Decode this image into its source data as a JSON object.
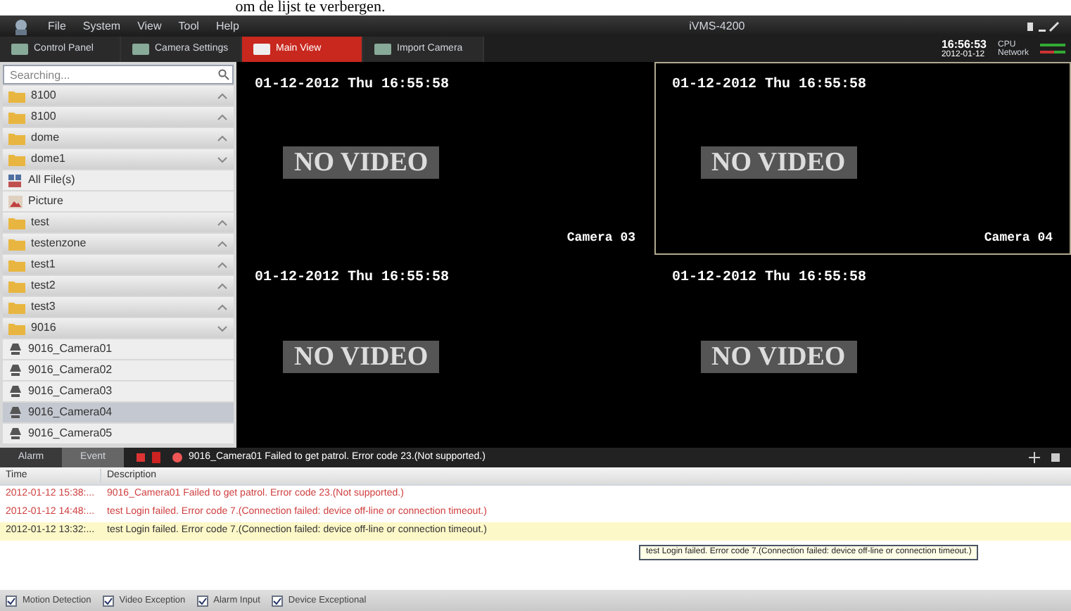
{
  "page_caption": "om de lijst te verbergen.",
  "window": {
    "title": "iVMS-4200"
  },
  "menu": [
    "File",
    "System",
    "View",
    "Tool",
    "Help"
  ],
  "toolbar_tabs": [
    {
      "label": "Control Panel",
      "selected": false
    },
    {
      "label": "Camera Settings",
      "selected": false
    },
    {
      "label": "Main View",
      "selected": true
    },
    {
      "label": "Import Camera",
      "selected": false
    }
  ],
  "status": {
    "time": "16:56:53",
    "date": "2012-01-12",
    "cpu_label": "CPU",
    "network_label": "Network"
  },
  "sidebar": {
    "search": {
      "placeholder": "Searching..."
    },
    "items": [
      {
        "kind": "folder",
        "label": "8100",
        "expanded": false
      },
      {
        "kind": "folder",
        "label": "8100",
        "expanded": false
      },
      {
        "kind": "folder",
        "label": "dome",
        "expanded": false
      },
      {
        "kind": "folder",
        "label": "dome1",
        "expanded": true
      },
      {
        "kind": "files",
        "label": "All File(s)"
      },
      {
        "kind": "picture",
        "label": "Picture"
      },
      {
        "kind": "folder",
        "label": "test",
        "expanded": false
      },
      {
        "kind": "folder",
        "label": "testenzone",
        "expanded": false
      },
      {
        "kind": "folder",
        "label": "test1",
        "expanded": false
      },
      {
        "kind": "folder",
        "label": "test2",
        "expanded": false
      },
      {
        "kind": "folder",
        "label": "test3",
        "expanded": false
      },
      {
        "kind": "folder",
        "label": "9016",
        "expanded": true
      },
      {
        "kind": "camera",
        "label": "9016_Camera01",
        "selected": false
      },
      {
        "kind": "camera",
        "label": "9016_Camera02",
        "selected": false
      },
      {
        "kind": "camera",
        "label": "9016_Camera03",
        "selected": false
      },
      {
        "kind": "camera",
        "label": "9016_Camera04",
        "selected": true
      },
      {
        "kind": "camera",
        "label": "9016_Camera05",
        "selected": false
      }
    ]
  },
  "video_tiles": [
    {
      "timestamp": "01-12-2012 Thu 16:55:58",
      "message": "NO VIDEO",
      "camera": "Camera 03",
      "selected": false
    },
    {
      "timestamp": "01-12-2012 Thu 16:55:58",
      "message": "NO VIDEO",
      "camera": "Camera 04",
      "selected": true
    },
    {
      "timestamp": "01-12-2012 Thu 16:55:58",
      "message": "NO VIDEO",
      "selected": false
    },
    {
      "timestamp": "01-12-2012 Thu 16:55:58",
      "message": "NO VIDEO",
      "selected": false
    }
  ],
  "event_bar": {
    "tabs": [
      {
        "label": "Alarm",
        "selected": false
      },
      {
        "label": "Event",
        "selected": true
      }
    ],
    "message": "9016_Camera01 Failed to get patrol. Error code 23.(Not supported.)"
  },
  "table": {
    "columns": [
      "Time",
      "Description"
    ],
    "rows": [
      {
        "time": "2012-01-12 15:38:...",
        "description": "9016_Camera01 Failed to get patrol. Error code 23.(Not supported.)",
        "color": "#d04040",
        "selected": false
      },
      {
        "time": "2012-01-12 14:48:...",
        "description": "test Login failed. Error code 7.(Connection failed: device off-line or connection timeout.)",
        "color": "#d04040",
        "selected": false
      },
      {
        "time": "2012-01-12 13:32:...",
        "description": "test Login failed. Error code 7.(Connection failed: device off-line or connection timeout.)",
        "color": "#333333",
        "selected": true
      }
    ]
  },
  "tooltip": "test Login failed. Error code 7.(Connection failed: device off-line or connection timeout.)",
  "filters": [
    {
      "label": "Motion Detection",
      "checked": true
    },
    {
      "label": "Video Exception",
      "checked": true
    },
    {
      "label": "Alarm Input",
      "checked": true
    },
    {
      "label": "Device Exceptional",
      "checked": true
    }
  ]
}
